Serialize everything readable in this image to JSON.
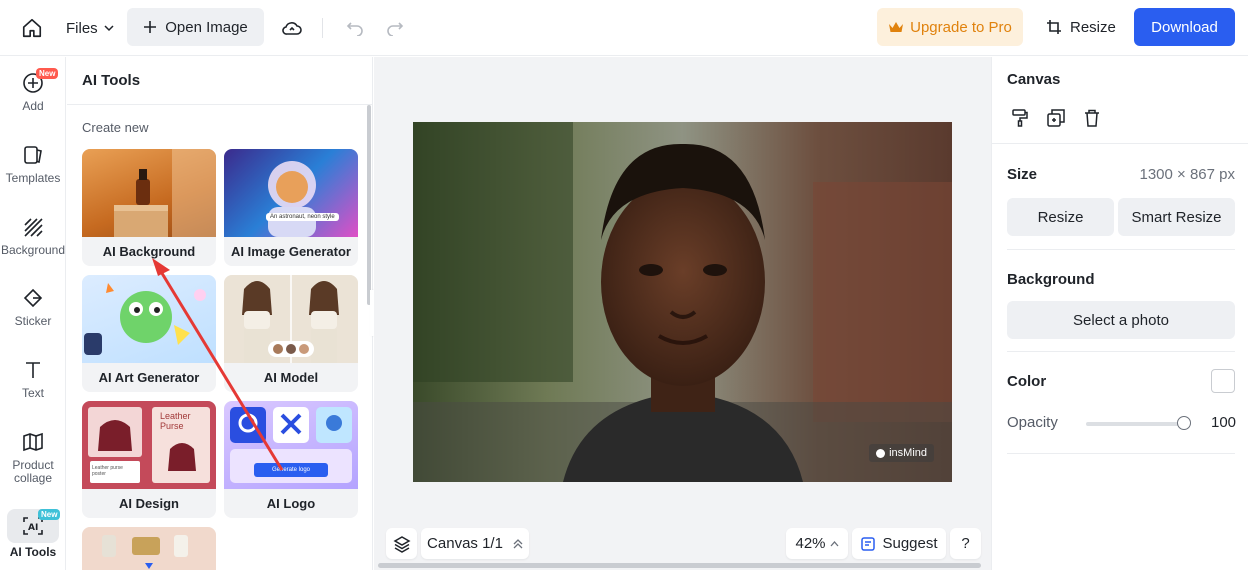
{
  "topbar": {
    "files_label": "Files",
    "open_image_label": "Open Image",
    "upgrade_label": "Upgrade to Pro",
    "resize_label": "Resize",
    "download_label": "Download"
  },
  "rail": {
    "items": [
      {
        "label": "Add",
        "icon": "plus-circle-icon",
        "badge": "New"
      },
      {
        "label": "Templates",
        "icon": "templates-icon"
      },
      {
        "label": "Background",
        "icon": "background-hatch-icon"
      },
      {
        "label": "Sticker",
        "icon": "sticker-icon"
      },
      {
        "label": "Text",
        "icon": "text-icon"
      },
      {
        "label": "Product collage",
        "icon": "product-collage-icon"
      },
      {
        "label": "AI Tools",
        "icon": "ai-tools-icon",
        "badge": "New",
        "active": true
      }
    ]
  },
  "tools_panel": {
    "title": "AI Tools",
    "section": "Create new",
    "cards": [
      {
        "label": "AI Background"
      },
      {
        "label": "AI Image Generator"
      },
      {
        "label": "AI Art Generator"
      },
      {
        "label": "AI Model"
      },
      {
        "label": "AI Design"
      },
      {
        "label": "AI Logo"
      }
    ],
    "thumb_text": {
      "image_generator_prompt": "An astronaut, neon style",
      "design_title": "Leather Purse",
      "design_caption": "Leather purse poster",
      "logo_button": "Generate logo"
    }
  },
  "canvas": {
    "page_label": "Canvas 1/1",
    "zoom": "42%",
    "suggest_label": "Suggest",
    "help_label": "?",
    "watermark": "insMind"
  },
  "right_panel": {
    "title": "Canvas",
    "size_label": "Size",
    "size_value": "1300 × 867 px",
    "resize_label": "Resize",
    "smart_resize_label": "Smart Resize",
    "background_label": "Background",
    "select_photo_label": "Select a photo",
    "color_label": "Color",
    "opacity_label": "Opacity",
    "opacity_value": "100"
  },
  "colors": {
    "accent": "#2a5ef0",
    "upgrade_text": "#e0820d",
    "upgrade_bg": "#fdf0dc",
    "annotation_arrow": "#e53935",
    "new_badge": "#ff5a4e"
  }
}
